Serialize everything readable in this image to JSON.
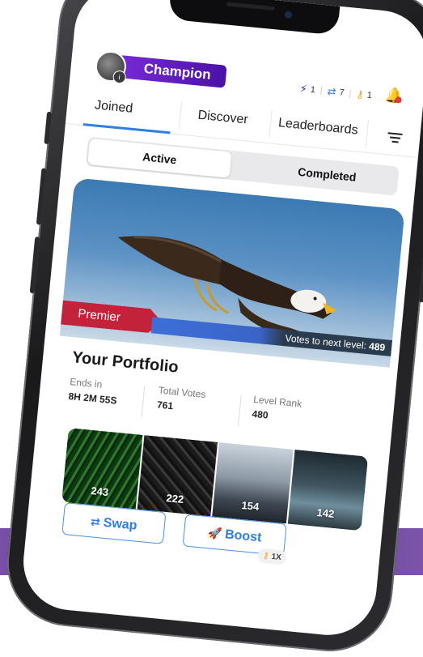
{
  "header": {
    "rank_label": "Champion",
    "avatar_badge": "i",
    "counters": [
      {
        "icon": "lightning-icon",
        "glyph": "⚡",
        "color": "#2a2ad0",
        "value": "1"
      },
      {
        "icon": "swap-icon",
        "glyph": "⇄",
        "color": "#2f7fe0",
        "value": "7"
      },
      {
        "icon": "key-icon",
        "glyph": "⚷",
        "color": "#f5a623",
        "value": "1"
      }
    ]
  },
  "tabs": [
    {
      "label": "Joined",
      "active": true
    },
    {
      "label": "Discover",
      "active": false
    },
    {
      "label": "Leaderboards",
      "active": false
    }
  ],
  "segmented": {
    "active_label": "Active",
    "completed_label": "Completed"
  },
  "hero": {
    "badge": "Premier",
    "votes_prefix": "Votes to next level:",
    "votes_value": "489"
  },
  "portfolio": {
    "title": "Your Portfolio",
    "stats": [
      {
        "label": "Ends in",
        "value": "8H 2M 55S"
      },
      {
        "label": "Total Votes",
        "value": "761"
      },
      {
        "label": "Level Rank",
        "value": "480"
      }
    ],
    "thumbnails": [
      {
        "votes": "243"
      },
      {
        "votes": "222"
      },
      {
        "votes": "154"
      },
      {
        "votes": "142"
      }
    ]
  },
  "actions": {
    "swap_label": "Swap",
    "boost_label": "Boost",
    "boost_count": "1X"
  },
  "colors": {
    "accent": "#2f7fe0",
    "champion": "#5a1dbf",
    "premier": "#c2233b"
  }
}
